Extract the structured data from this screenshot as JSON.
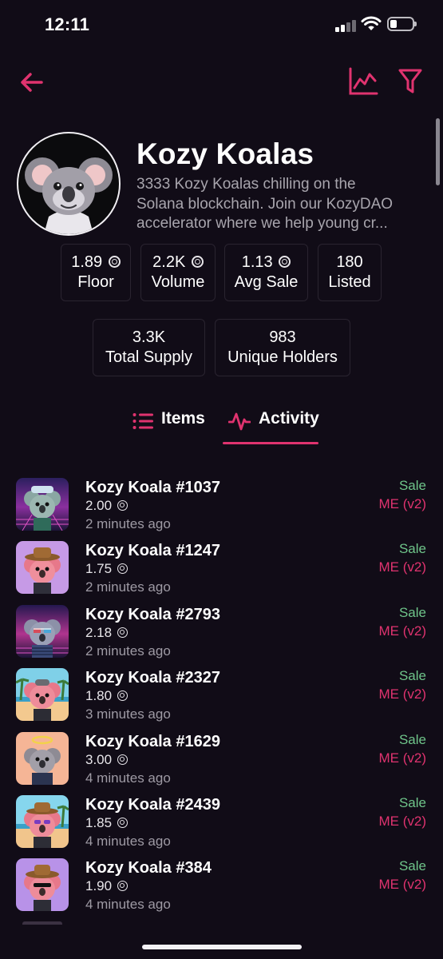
{
  "status_bar": {
    "time": "12:11"
  },
  "collection": {
    "name": "Kozy Koalas",
    "description_lines": [
      "3333 Kozy Koalas chilling on the",
      "Solana blockchain. Join our KozyDAO",
      "accelerator where we help young cr..."
    ]
  },
  "stats": [
    {
      "value": "1.89",
      "label": "Floor",
      "token": true
    },
    {
      "value": "2.2K",
      "label": "Volume",
      "token": true
    },
    {
      "value": "1.13",
      "label": "Avg Sale",
      "token": true
    },
    {
      "value": "180",
      "label": "Listed",
      "token": false
    },
    {
      "value": "3.3K",
      "label": "Total Supply",
      "token": false
    },
    {
      "value": "983",
      "label": "Unique Holders",
      "token": false
    }
  ],
  "tabs": {
    "items": "Items",
    "activity": "Activity",
    "active": "activity"
  },
  "activity": [
    {
      "name": "Kozy Koala #1037",
      "price": "2.00",
      "time": "2 minutes ago",
      "type": "Sale",
      "market": "ME (v2)"
    },
    {
      "name": "Kozy Koala #1247",
      "price": "1.75",
      "time": "2 minutes ago",
      "type": "Sale",
      "market": "ME (v2)"
    },
    {
      "name": "Kozy Koala #2793",
      "price": "2.18",
      "time": "2 minutes ago",
      "type": "Sale",
      "market": "ME (v2)"
    },
    {
      "name": "Kozy Koala #2327",
      "price": "1.80",
      "time": "3 minutes ago",
      "type": "Sale",
      "market": "ME (v2)"
    },
    {
      "name": "Kozy Koala #1629",
      "price": "3.00",
      "time": "4 minutes ago",
      "type": "Sale",
      "market": "ME (v2)"
    },
    {
      "name": "Kozy Koala #2439",
      "price": "1.85",
      "time": "4 minutes ago",
      "type": "Sale",
      "market": "ME (v2)"
    },
    {
      "name": "Kozy Koala #384",
      "price": "1.90",
      "time": "4 minutes ago",
      "type": "Sale",
      "market": "ME (v2)"
    }
  ],
  "colors": {
    "background": "#110c17",
    "accent": "#e0336f",
    "sale_green": "#6fc58a",
    "muted_text": "#a8a5ad",
    "card_border": "#2a2430"
  },
  "icons": {
    "back": "arrow-left-icon",
    "chart": "line-chart-icon",
    "filter": "filter-funnel-icon",
    "items_tab": "list-icon",
    "activity_tab": "pulse-icon",
    "currency": "solana-token-icon"
  }
}
